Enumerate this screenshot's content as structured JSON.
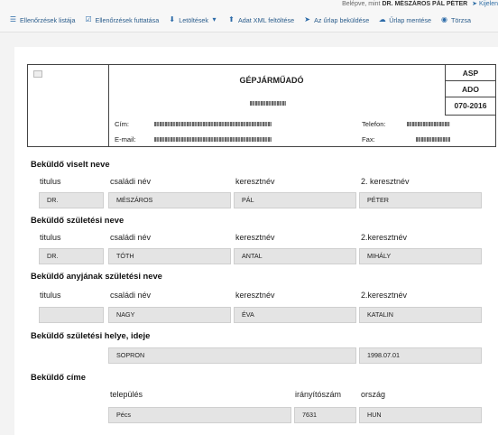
{
  "topbar": {
    "login_prefix": "Belépve, mint",
    "user_name": "DR. MÉSZÁROS PÁL PÉTER",
    "logout_label": "Kijelen",
    "nav": [
      {
        "label": "Ellenőrzések listája",
        "icon": "list-icon"
      },
      {
        "label": "Ellenőrzések futtatása",
        "icon": "check-icon"
      },
      {
        "label": "Letöltések",
        "icon": "download-icon"
      },
      {
        "label": "Adat XML feltöltése",
        "icon": "upload-icon"
      },
      {
        "label": "Az űrlap beküldése",
        "icon": "send-icon"
      },
      {
        "label": "Űrlap mentése",
        "icon": "cloud-save-icon"
      },
      {
        "label": "Törzsa",
        "icon": "user-icon"
      }
    ]
  },
  "header": {
    "title": "GÉPJÁRMŰADÓ",
    "codes": [
      "ASP",
      "ADO",
      "070-2016"
    ],
    "address_label": "Cím:",
    "email_label": "E-mail:",
    "phone_label": "Telefon:",
    "fax_label": "Fax:"
  },
  "sections": {
    "name": {
      "title": "Beküldő viselt neve",
      "cols": [
        "titulus",
        "családi név",
        "keresztnév",
        "2. keresztnév"
      ],
      "values": [
        "DR.",
        "MÉSZÁROS",
        "PÁL",
        "PÉTER"
      ]
    },
    "birth_name": {
      "title": "Beküldő születési neve",
      "cols": [
        "titulus",
        "családi név",
        "keresztnév",
        "2.keresztnév"
      ],
      "values": [
        "DR.",
        "TÓTH",
        "ANTAL",
        "MIHÁLY"
      ]
    },
    "mother_name": {
      "title": "Beküldő anyjának születési neve",
      "cols": [
        "titulus",
        "családi név",
        "keresztnév",
        "2.keresztnév"
      ],
      "values": [
        "",
        "NAGY",
        "ÉVA",
        "KATALIN"
      ]
    },
    "birth_place": {
      "title": "Beküldő születési helye, ideje",
      "place": "SOPRON",
      "date": "1998.07.01"
    },
    "address": {
      "title": "Beküldő címe",
      "cols": [
        "település",
        "irányítószám",
        "ország"
      ],
      "values": [
        "Pécs",
        "7631",
        "HUN"
      ]
    }
  }
}
